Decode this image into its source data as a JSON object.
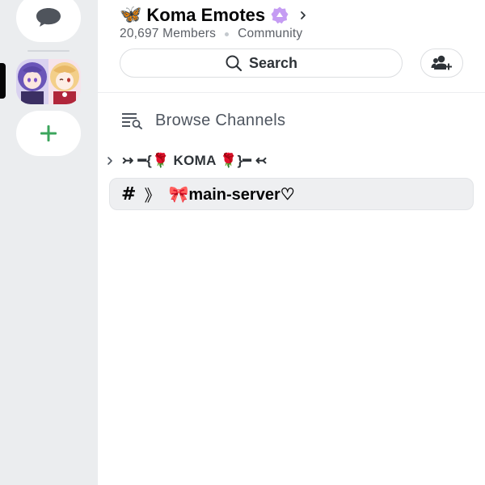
{
  "server": {
    "emoji": "🦋",
    "name": "Koma Emotes",
    "members": "20,697 Members",
    "type": "Community"
  },
  "search": {
    "label": "Search"
  },
  "browse": {
    "label": "Browse Channels"
  },
  "category": {
    "label": "↣ ━{🌹 KOMA 🌹}━ ↢"
  },
  "channel": {
    "prefix": "》",
    "emoji": "🎀",
    "name": "main-server♡"
  },
  "icons": {
    "dm": "chat-bubble-icon",
    "add": "plus-icon",
    "boost": "boost-badge-icon",
    "search": "search-icon",
    "invite": "add-member-icon",
    "browse": "browse-channels-icon"
  },
  "colors": {
    "rail_bg": "#ebedef",
    "accent_green": "#3ba55c",
    "boost_purple": "#c59cf3",
    "text_primary": "#060607",
    "text_muted": "#5c6067"
  }
}
